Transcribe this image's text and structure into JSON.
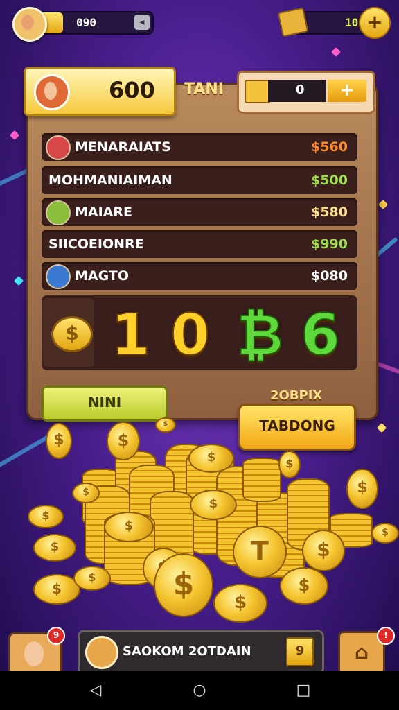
{
  "topbar": {
    "coin_value": "090",
    "coin_fill_pct": 22,
    "coin_button": "◂",
    "gem_value": "10",
    "plus": "+"
  },
  "panel": {
    "score": "600",
    "tab_label": "TANI",
    "cash_value": "0",
    "cash_plus": "+"
  },
  "leaderboard": [
    {
      "name": "MENARAIATS",
      "amount": "$560",
      "amount_color": "#ff8a2a",
      "has_avatar": true,
      "avatar_color": "#d8484a"
    },
    {
      "name": "MOHMANIAIMAN",
      "amount": "$500",
      "amount_color": "#9be04a",
      "has_avatar": false
    },
    {
      "name": "MAIARE",
      "amount": "$580",
      "amount_color": "#ffe08a",
      "has_avatar": true,
      "avatar_color": "#8abe3a"
    },
    {
      "name": "SIICOEIONRE",
      "amount": "$990",
      "amount_color": "#9be04a",
      "has_avatar": false
    },
    {
      "name": "MAGTO",
      "amount": "$080",
      "amount_color": "#ffffff",
      "has_avatar": true,
      "avatar_color": "#3a7ad0"
    }
  ],
  "big_display": {
    "icon": "$",
    "digits": [
      "1",
      "0",
      "₿",
      "6"
    ]
  },
  "buttons": {
    "green_label": "NINI",
    "promo_label": "2OBPIX",
    "gold_label": "TABDONG"
  },
  "bottom": {
    "avatar_badge": "9",
    "bar_text": "SAOKOM 2OTDAIN",
    "bar_icon": "9",
    "home_badge": "!",
    "home_icon": "⌂"
  },
  "navbar": {
    "back": "◁",
    "home": "○",
    "recents": "□"
  },
  "colors": {
    "background": "#4a1f8e",
    "panel": "#a87850",
    "gold": "#f5c531",
    "green": "#5ed83a"
  }
}
